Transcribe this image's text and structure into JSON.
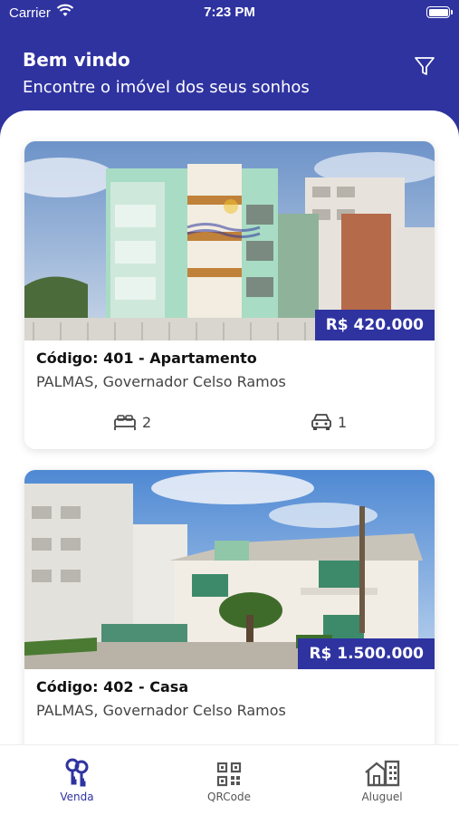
{
  "status_bar": {
    "carrier": "Carrier",
    "time": "7:23 PM"
  },
  "header": {
    "title": "Bem vindo",
    "subtitle": "Encontre o imóvel dos seus sonhos",
    "filter_icon": "filter-icon"
  },
  "colors": {
    "brand": "#2f33a0",
    "price_bg": "#2f33a0"
  },
  "listings": [
    {
      "title": "Código: 401 - Apartamento",
      "location": "PALMAS, Governador Celso Ramos",
      "price": "R$ 420.000",
      "bedrooms": "2",
      "garage": "1"
    },
    {
      "title": "Código: 402 - Casa",
      "location": "PALMAS, Governador Celso Ramos",
      "price": "R$ 1.500.000"
    }
  ],
  "tabbar": {
    "tabs": [
      {
        "label": "Venda",
        "icon": "keys-icon",
        "active": true
      },
      {
        "label": "QRCode",
        "icon": "qrcode-icon",
        "active": false
      },
      {
        "label": "Aluguel",
        "icon": "house-icon",
        "active": false
      }
    ]
  }
}
